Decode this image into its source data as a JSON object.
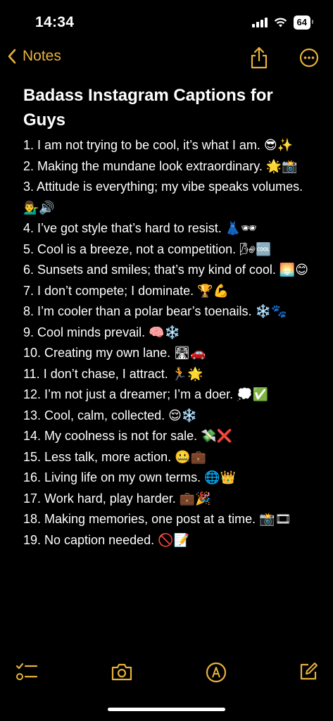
{
  "status": {
    "time": "14:34",
    "battery": "64"
  },
  "nav": {
    "back_label": "Notes"
  },
  "note": {
    "title": "Badass Instagram Captions for Guys",
    "lines": [
      {
        "text": "1. I am not trying to be cool, it’s what I am.",
        "emoji": "😎✨"
      },
      {
        "text": "2. Making the mundane look extraordinary.",
        "emoji": "🌟📸"
      },
      {
        "text": "3. Attitude is everything; my vibe speaks volumes.",
        "emoji": "💁‍♂️🔊"
      },
      {
        "text": "4. I’ve got style that’s hard to resist.",
        "emoji": "👗🕶"
      },
      {
        "text": "5. Cool is a breeze, not a competition.",
        "emoji": "🌬🆒"
      },
      {
        "text": "6. Sunsets and smiles; that’s my kind of cool.",
        "emoji": "🌅😊"
      },
      {
        "text": "7. I don’t compete; I dominate.",
        "emoji": "🏆💪"
      },
      {
        "text": "8. I’m cooler than a polar bear’s toenails.",
        "emoji": "❄️🐾"
      },
      {
        "text": "9. Cool minds prevail.",
        "emoji": "🧠❄️"
      },
      {
        "text": "10. Creating my own lane.",
        "emoji": "🛣🚗"
      },
      {
        "text": "11. I don’t chase, I attract.",
        "emoji": "🏃🌟"
      },
      {
        "text": "12. I’m not just a dreamer; I’m a doer.",
        "emoji": "💭✅"
      },
      {
        "text": "13. Cool, calm, collected.",
        "emoji": "😌❄️"
      },
      {
        "text": "14. My coolness is not for sale.",
        "emoji": "💸❌"
      },
      {
        "text": "15. Less talk, more action.",
        "emoji": "🤐💼"
      },
      {
        "text": "16. Living life on my own terms.",
        "emoji": "🌐👑"
      },
      {
        "text": "17. Work hard, play harder.",
        "emoji": "💼🎉"
      },
      {
        "text": "18. Making memories, one post at a time.",
        "emoji": "📸🎞"
      },
      {
        "text": "19. No caption needed.",
        "emoji": "🚫📝"
      }
    ]
  },
  "colors": {
    "accent": "#e7b23c",
    "background": "#000000",
    "text": "#ffffff"
  },
  "icons": {
    "nav": [
      "chevron-left-icon",
      "share-icon",
      "more-icon"
    ],
    "toolbar": [
      "checklist-icon",
      "camera-icon",
      "markup-icon",
      "compose-icon"
    ]
  }
}
